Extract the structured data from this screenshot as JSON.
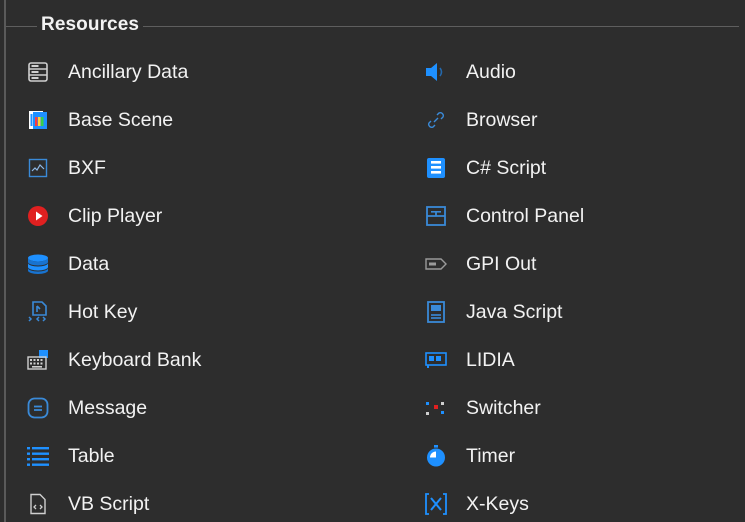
{
  "group": {
    "title": "Resources"
  },
  "colors": {
    "background": "#2d2d2d",
    "text": "#f2f2f2",
    "accent_blue": "#1e90ff",
    "clip_red": "#e02020"
  },
  "left_column": [
    {
      "label": "Ancillary Data",
      "icon": "ancillary-data-icon"
    },
    {
      "label": "Base Scene",
      "icon": "base-scene-icon"
    },
    {
      "label": "BXF",
      "icon": "bxf-icon"
    },
    {
      "label": "Clip Player",
      "icon": "clip-player-icon"
    },
    {
      "label": "Data",
      "icon": "data-icon"
    },
    {
      "label": "Hot Key",
      "icon": "hot-key-icon"
    },
    {
      "label": "Keyboard Bank",
      "icon": "keyboard-bank-icon"
    },
    {
      "label": "Message",
      "icon": "message-icon"
    },
    {
      "label": "Table",
      "icon": "table-icon"
    },
    {
      "label": "VB Script",
      "icon": "vb-script-icon"
    }
  ],
  "right_column": [
    {
      "label": "Audio",
      "icon": "audio-icon"
    },
    {
      "label": "Browser",
      "icon": "browser-icon"
    },
    {
      "label": "C# Script",
      "icon": "csharp-script-icon"
    },
    {
      "label": "Control Panel",
      "icon": "control-panel-icon"
    },
    {
      "label": "GPI Out",
      "icon": "gpi-out-icon"
    },
    {
      "label": "Java Script",
      "icon": "java-script-icon"
    },
    {
      "label": "LIDIA",
      "icon": "lidia-icon"
    },
    {
      "label": "Switcher",
      "icon": "switcher-icon"
    },
    {
      "label": "Timer",
      "icon": "timer-icon"
    },
    {
      "label": "X-Keys",
      "icon": "x-keys-icon"
    }
  ]
}
